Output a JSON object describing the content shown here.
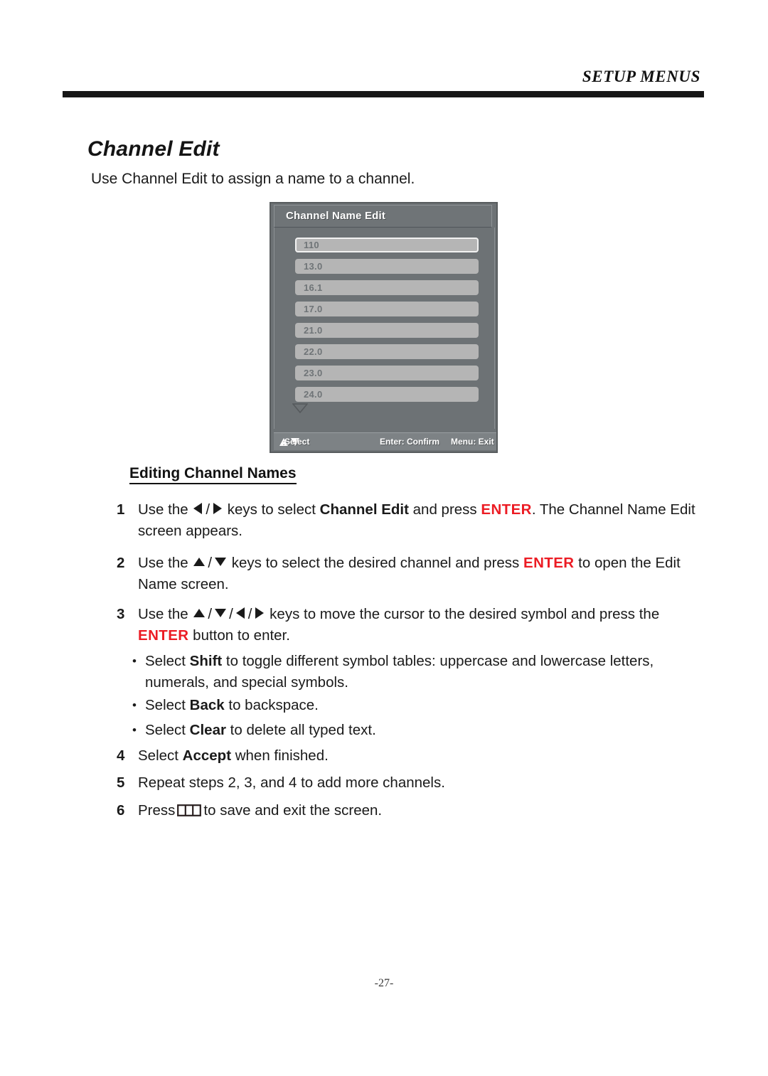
{
  "header": {
    "running_title": "SETUP MENUS"
  },
  "page": {
    "section_title": "Channel Edit",
    "intro": "Use Channel Edit to assign a name to a channel.",
    "sub_heading": "Editing Channel Names",
    "page_number": "-27-"
  },
  "osd": {
    "title": "Channel Name Edit",
    "rows": [
      {
        "label": "110",
        "selected": true
      },
      {
        "label": "13.0",
        "selected": false
      },
      {
        "label": "16.1",
        "selected": false
      },
      {
        "label": "17.0",
        "selected": false
      },
      {
        "label": "21.0",
        "selected": false
      },
      {
        "label": "22.0",
        "selected": false
      },
      {
        "label": "23.0",
        "selected": false
      },
      {
        "label": "24.0",
        "selected": false
      }
    ],
    "scroll_more_icon": "triangle-down-outline-icon",
    "footer": {
      "select": ":Select",
      "confirm": "Enter: Confirm",
      "exit": "Menu: Exit"
    }
  },
  "steps": {
    "s1": {
      "num": "1",
      "t1": "Use the ",
      "t2": " keys to select ",
      "kw": "Channel Edit",
      "t3": " and press ",
      "enter": "ENTER",
      "t4": ". The Channel Name Edit screen appears."
    },
    "s2": {
      "num": "2",
      "t1": "Use the ",
      "t2": " keys to select the desired channel and press ",
      "enter": "ENTER",
      "t3": " to open the Edit Name screen."
    },
    "s3": {
      "num": "3",
      "t1": "Use the ",
      "t2": " keys to move the cursor to the desired symbol and press the ",
      "enter": "ENTER",
      "t3": " button to enter."
    },
    "s4": {
      "num": "4",
      "t1": "Select ",
      "kw": "Accept",
      "t2": " when finished."
    },
    "s5": {
      "num": "5",
      "t1": "Repeat steps 2, 3, and 4 to add more channels."
    },
    "s6": {
      "num": "6",
      "t1": "Press",
      "t2": "to save and exit the screen."
    }
  },
  "bullets": [
    {
      "dot": "•",
      "t1": "Select  ",
      "kw": "Shift",
      "t2": " to toggle different symbol tables: uppercase and lowercase letters, numerals, and special symbols."
    },
    {
      "dot": "•",
      "t1": "Select  ",
      "kw": "Back",
      "t2": " to backspace."
    },
    {
      "dot": "•",
      "t1": "Select ",
      "kw": "Clear",
      "t2": "  to delete all typed text."
    }
  ],
  "colors": {
    "enter_red": "#ec1c24",
    "osd_background": "#6d7275",
    "osd_row": "#b5b5b5",
    "osd_row_text": "#6f7477",
    "osd_footer": "#7d8285"
  }
}
